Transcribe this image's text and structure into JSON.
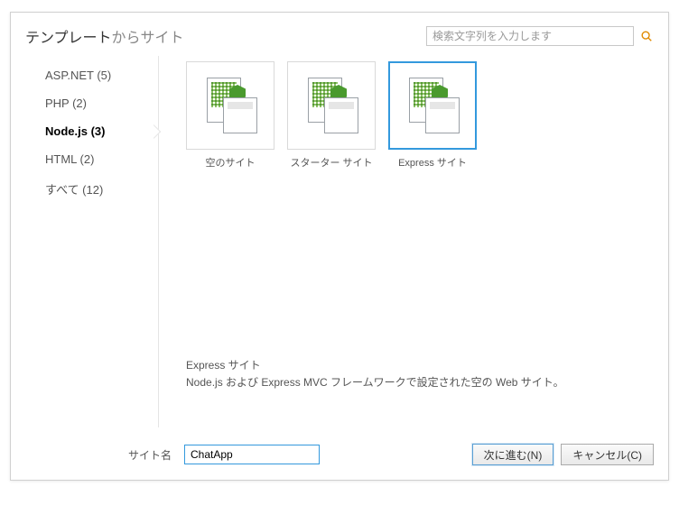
{
  "title_bold": "テンプレート",
  "title_light": "からサイト",
  "search": {
    "placeholder": "検索文字列を入力します"
  },
  "sidebar": {
    "items": [
      {
        "label": "ASP.NET (5)",
        "selected": false
      },
      {
        "label": "PHP (2)",
        "selected": false
      },
      {
        "label": "Node.js (3)",
        "selected": true
      },
      {
        "label": "HTML (2)",
        "selected": false
      },
      {
        "label": "すべて (12)",
        "selected": false
      }
    ]
  },
  "templates": [
    {
      "label": "空のサイト",
      "selected": false
    },
    {
      "label": "スターター サイト",
      "selected": false
    },
    {
      "label": "Express サイト",
      "selected": true
    }
  ],
  "description": {
    "heading": "Express サイト",
    "body": "Node.js および Express MVC フレームワークで設定された空の Web サイト。"
  },
  "footer": {
    "site_name_label": "サイト名",
    "site_name_value": "ChatApp",
    "next_label": "次に進む(N)",
    "cancel_label": "キャンセル(C)"
  }
}
